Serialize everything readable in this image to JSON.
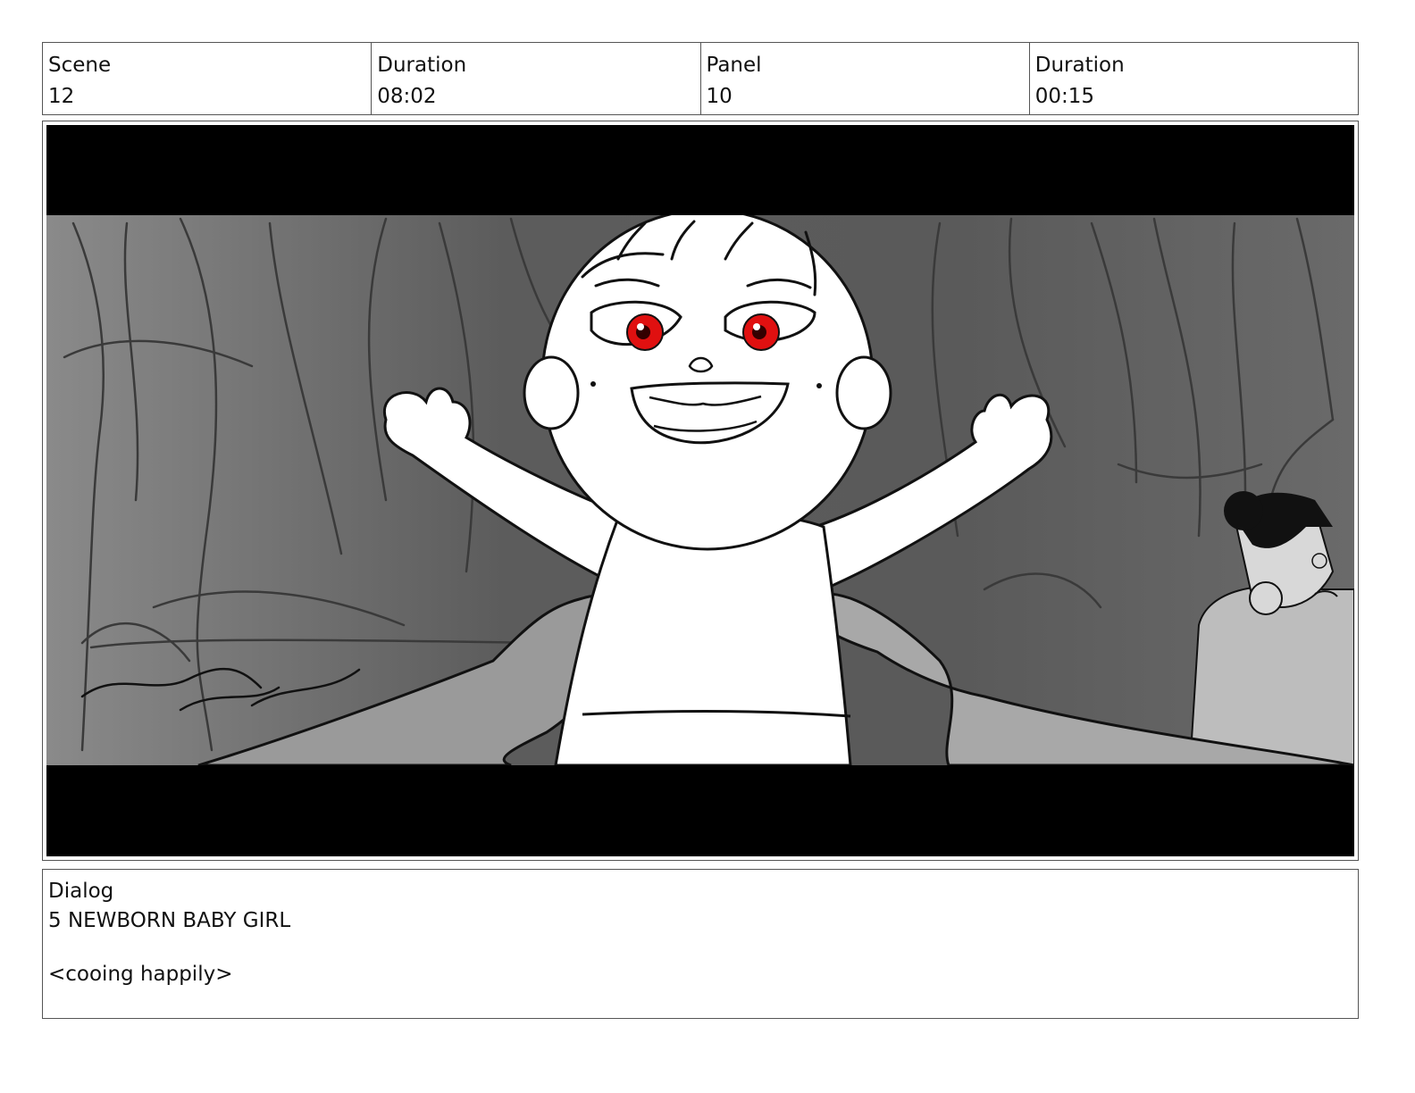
{
  "header": {
    "cells": [
      {
        "label": "Scene",
        "value": "12"
      },
      {
        "label": "Duration",
        "value": "08:02"
      },
      {
        "label": "Panel",
        "value": "10"
      },
      {
        "label": "Duration",
        "value": "00:15"
      }
    ]
  },
  "frame": {
    "subject": "storyboard sketch of a smiling baby with red eyes lifted up by two hands",
    "colors": {
      "letterbox": "#000000",
      "background": "#5e5e5e",
      "eyes": "#e01010",
      "figure": "#ffffff",
      "hands": "#9a9a9a"
    }
  },
  "dialog": {
    "label": "Dialog",
    "text": "5 NEWBORN BABY GIRL\n\n<cooing happily>"
  }
}
